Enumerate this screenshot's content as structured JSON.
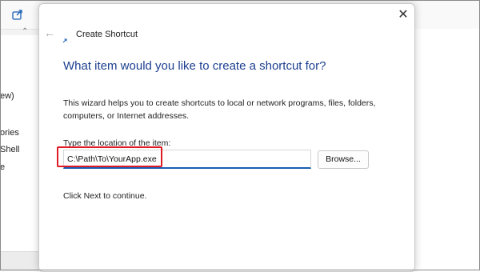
{
  "background": {
    "side_items": [
      "ew)",
      "ories",
      "Shell",
      "e"
    ]
  },
  "dialog": {
    "title": "Create Shortcut",
    "heading": "What item would you like to create a shortcut for?",
    "description": "This wizard helps you to create shortcuts to local or network programs, files, folders, computers, or Internet addresses.",
    "location_label": "Type the location of the item:",
    "location_value": "C:\\Path\\To\\YourApp.exe",
    "browse_label": "Browse...",
    "hint": "Click Next to continue."
  },
  "icons": {
    "close": "close-icon",
    "back": "back-arrow-icon",
    "shortcut": "shortcut-icon",
    "share": "share-icon"
  },
  "colors": {
    "heading": "#1c3f8f",
    "input_accent": "#1a5fb4",
    "highlight": "#e01b24"
  }
}
